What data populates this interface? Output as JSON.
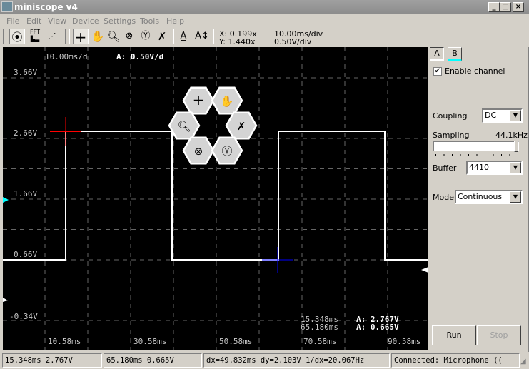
{
  "window": {
    "title": "miniscope v4"
  },
  "menu": [
    "File",
    "Edit",
    "View",
    "Device",
    "Settings",
    "Tools",
    "Help"
  ],
  "toolbar": {
    "mode_icons": [
      "oscilloscope-icon",
      "fft-icon",
      "xy-plot-icon"
    ],
    "fft_label": "FFT",
    "tool_icons": [
      "crosshair-icon",
      "hand-pan-icon",
      "zoom-icon",
      "zoom-x-icon",
      "zoom-y-icon",
      "zoom-reset-icon",
      "cursor-a-horizontal-icon",
      "cursor-a-vertical-icon"
    ],
    "x_zoom": "X: 0.199x",
    "y_zoom": "Y: 1.440x",
    "timebase": "10.00ms/div",
    "volts": "0.50V/div"
  },
  "plot": {
    "time_div": "10.00ms/d",
    "volt_div": "A: 0.50V/d",
    "y_labels": [
      "3.66V",
      "2.66V",
      "1.66V",
      "0.66V",
      "-0.34V"
    ],
    "x_labels": [
      "10.58ms",
      "30.58ms",
      "50.58ms",
      "70.58ms",
      "90.58ms"
    ],
    "cursor_readout": [
      {
        "t": "15.348ms",
        "v": "A: 2.767V"
      },
      {
        "t": "65.180ms",
        "v": "A: 0.665V"
      }
    ],
    "cursor1_color": "#ff0000",
    "cursor2_color": "#0000ff",
    "trace_color": "#ffffff",
    "channel_b_color": "#00ffff"
  },
  "hex_menu": [
    "crosshair-icon",
    "hand-pan-icon",
    "zoom-icon",
    "zoom-reset-icon",
    "zoom-x-icon",
    "zoom-y-icon"
  ],
  "panel": {
    "channel_a": "A",
    "channel_b": "B",
    "enable_channel": "Enable channel",
    "enable_checked": true,
    "coupling_label": "Coupling",
    "coupling_value": "DC",
    "sampling_label": "Sampling",
    "sampling_value": "44.1kHz",
    "sampling_level": 1.0,
    "buffer_label": "Buffer",
    "buffer_value": "4410",
    "mode_label": "Mode",
    "mode_value": "Continuous",
    "run": "Run",
    "stop": "Stop"
  },
  "status": [
    "15.348ms 2.767V",
    "65.180ms 0.665V",
    "dx=49.832ms dy=2.103V 1/dx=20.067Hz",
    "Connected: Microphone (("
  ]
}
